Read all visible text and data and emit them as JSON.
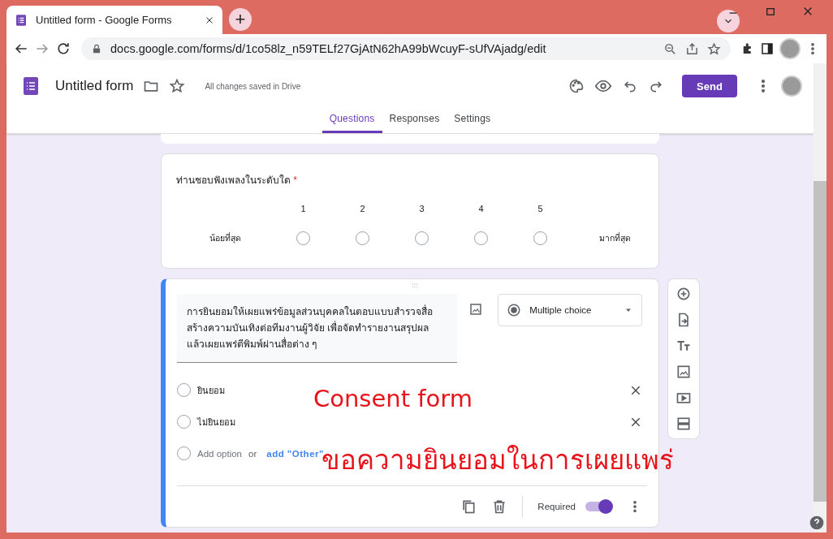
{
  "browser": {
    "tab_title": "Untitled form - Google Forms",
    "new_tab": "+",
    "url": "docs.google.com/forms/d/1co58lz_n59TELf27GjAtN62hA99bWcuyF-sUfVAjadg/edit"
  },
  "form_header": {
    "title": "Untitled form",
    "saved_note": "All changes saved in Drive",
    "send_button": "Send",
    "tabs": [
      {
        "label": "Questions",
        "selected": true
      },
      {
        "label": "Responses",
        "selected": false
      },
      {
        "label": "Settings",
        "selected": false
      }
    ]
  },
  "questions": [
    {
      "kind": "linear_scale",
      "focused": false,
      "title": "ท่านชอบฟังเพลงในระดับใด",
      "required": true,
      "required_mark": "*",
      "points": [
        "1",
        "2",
        "3",
        "4",
        "5"
      ],
      "low_label": "น้อยที่สุด",
      "high_label": "มากที่สุด"
    },
    {
      "kind": "multiple_choice",
      "focused": true,
      "title": "การยินยอมให้เผยแพร่ข้อมูลส่วนบุคคลในตอบแบบสำรวจสื่อสร้างความบันเทิงต่อทีมงานผู้วิจัย เพื่อจัดทำรายงานสรุปผล แล้วเผยแพร่ตีพิมพ์ผ่านสื่อต่าง ๆ",
      "type_label": "Multiple choice",
      "options": [
        "ยินยอม",
        "ไม่ยินยอม"
      ],
      "add_option": "Add option",
      "or": "or",
      "add_other": "add \"Other\"",
      "required_label": "Required",
      "required": true
    }
  ],
  "annotations": [
    {
      "text": "Consent form"
    },
    {
      "text": "ขอความยินยอมในการเผยแพร่"
    }
  ]
}
